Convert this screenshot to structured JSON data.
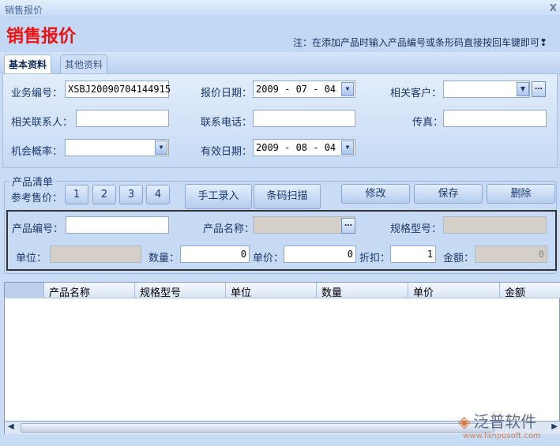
{
  "window": {
    "title": "销售报价",
    "close": "X"
  },
  "header": {
    "title": "销售报价",
    "note": "注：在添加产品时输入产品编号或条形码直接按回车键即可❢"
  },
  "tabs": [
    {
      "label": "基本资料",
      "active": true
    },
    {
      "label": "其他资料",
      "active": false
    }
  ],
  "form": {
    "biz_no_label": "业务编号：",
    "biz_no": "XSBJ20090704144915",
    "quote_date_label": "报价日期：",
    "quote_date": "2009 - 07 - 04",
    "customer_label": "相关客户：",
    "customer": "",
    "contact_label": "相关联系人：",
    "contact": "",
    "phone_label": "联系电话：",
    "phone": "",
    "fax_label": "传真：",
    "fax": "",
    "prob_label": "机会概率：",
    "prob": "",
    "valid_date_label": "有效日期：",
    "valid_date": "2009 - 08 - 04"
  },
  "products": {
    "group_title": "产品清单",
    "ref_price_label": "参考售价：",
    "ref_buttons": [
      "1",
      "2",
      "3",
      "4"
    ],
    "manual": "手工录入",
    "scan": "条码扫描",
    "edit": "修改",
    "save": "保存",
    "delete": "删除",
    "code_label": "产品编号：",
    "code": "",
    "name_label": "产品名称：",
    "name": "",
    "spec_label": "规格型号：",
    "spec": "",
    "unit_label": "单位：",
    "unit": "",
    "qty_label": "数量：",
    "qty": "0",
    "price_label": "单价：",
    "price": "0",
    "discount_label": "折扣：",
    "discount": "1",
    "amount_label": "金额：",
    "amount": "0"
  },
  "grid": {
    "columns": [
      "产品名称",
      "规格型号",
      "单位",
      "数量",
      "单价",
      "金额"
    ]
  },
  "watermark": {
    "brand": "泛普软件",
    "url": "www.fanpusoft.com"
  }
}
